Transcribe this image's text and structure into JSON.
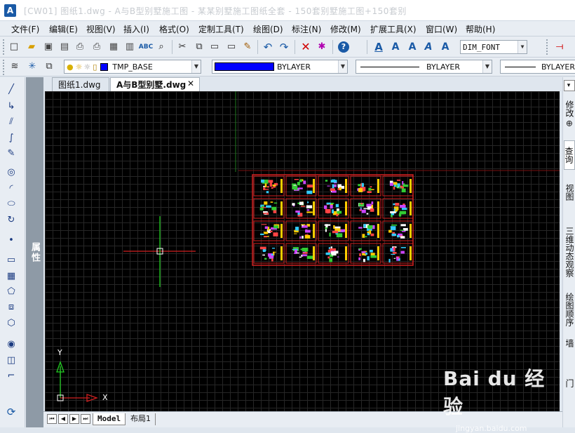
{
  "app": {
    "logo_text": "A",
    "title": "[CW01] 图纸1.dwg - A与B型别墅施工图 - 某某别墅施工图纸全套 - 150套别墅施工图+150套别"
  },
  "menu": [
    {
      "label": "文件(F)"
    },
    {
      "label": "编辑(E)"
    },
    {
      "label": "视图(V)"
    },
    {
      "label": "插入(I)"
    },
    {
      "label": "格式(O)"
    },
    {
      "label": "定制工具(T)"
    },
    {
      "label": "绘图(D)"
    },
    {
      "label": "标注(N)"
    },
    {
      "label": "修改(M)"
    },
    {
      "label": "扩展工具(X)"
    },
    {
      "label": "窗口(W)"
    },
    {
      "label": "帮助(H)"
    }
  ],
  "toolbar": {
    "dim_font": "DIM_FONT"
  },
  "props_bar": {
    "layer": "TMP_BASE",
    "color_label": "BYLAYER",
    "color_hex": "#0000ff",
    "linetype": "BYLAYER",
    "lineweight": "BYLAYER"
  },
  "left_panel": {
    "label": "属性"
  },
  "doc_tabs": [
    {
      "label": "图纸1.dwg"
    },
    {
      "label": "A与B型别墅.dwg",
      "active": true
    }
  ],
  "layout_tabs": [
    {
      "label": "Model"
    },
    {
      "label": "布局1"
    }
  ],
  "right_panel": [
    {
      "label": "修改 ⊕"
    },
    {
      "label": "查询"
    },
    {
      "label": "视图"
    },
    {
      "label": "三维动态观察"
    },
    {
      "label": "绘图顺序"
    },
    {
      "label": "墙"
    },
    {
      "label": "门"
    }
  ],
  "ucs": {
    "x_label": "X",
    "y_label": "Y"
  },
  "watermark": {
    "brand": "Bai du 经验",
    "url": "jingyan.baidu.com"
  },
  "colors": {
    "canvas_bg": "#000000",
    "frame_red": "#d02020",
    "ucs_green": "#22cc22"
  }
}
